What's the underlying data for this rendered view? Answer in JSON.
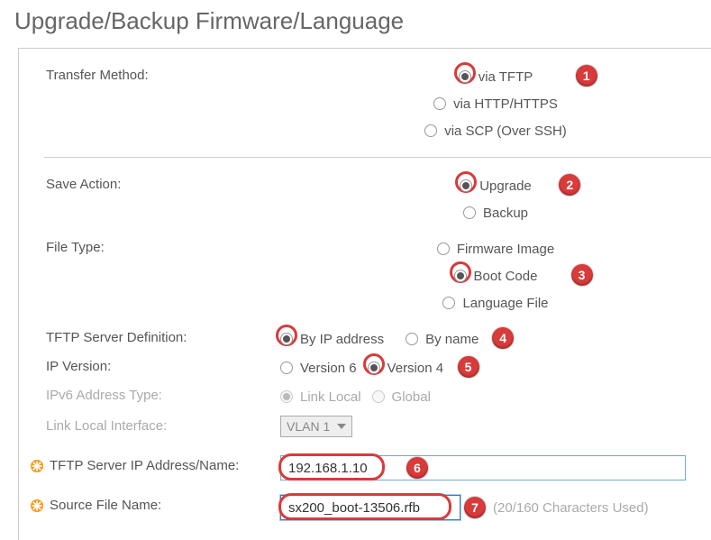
{
  "title": "Upgrade/Backup Firmware/Language",
  "transferMethod": {
    "label": "Transfer Method:",
    "options": {
      "tftp": "via TFTP",
      "http": "via HTTP/HTTPS",
      "scp": "via SCP (Over SSH)"
    },
    "selected": "tftp",
    "badge": "1"
  },
  "saveAction": {
    "label": "Save Action:",
    "options": {
      "upgrade": "Upgrade",
      "backup": "Backup"
    },
    "selected": "upgrade",
    "badge": "2"
  },
  "fileType": {
    "label": "File Type:",
    "options": {
      "firmware": "Firmware Image",
      "boot": "Boot Code",
      "lang": "Language File"
    },
    "selected": "boot",
    "badge": "3"
  },
  "serverDef": {
    "label": "TFTP Server Definition:",
    "options": {
      "ip": "By IP address",
      "name": "By name"
    },
    "selected": "ip",
    "badge": "4"
  },
  "ipVersion": {
    "label": "IP Version:",
    "options": {
      "v6": "Version 6",
      "v4": "Version 4"
    },
    "selected": "v4",
    "badge": "5"
  },
  "ipv6Type": {
    "label": "IPv6 Address Type:",
    "options": {
      "linklocal": "Link Local",
      "global": "Global"
    },
    "selected": "linklocal"
  },
  "linkLocalIf": {
    "label": "Link Local Interface:",
    "value": "VLAN 1"
  },
  "serverAddr": {
    "label": "TFTP Server IP Address/Name:",
    "value": "192.168.1.10",
    "badge": "6"
  },
  "sourceFile": {
    "label": "Source File Name:",
    "value": "sx200_boot-13506.rfb",
    "hint": "(20/160 Characters Used)",
    "badge": "7"
  }
}
